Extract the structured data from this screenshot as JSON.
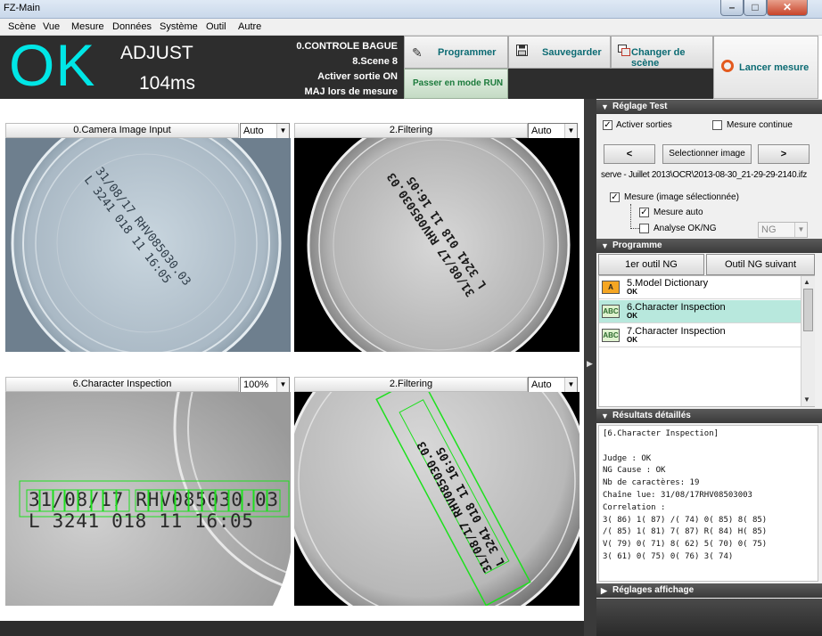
{
  "window": {
    "title": "FZ-Main",
    "min_glyph": "–",
    "max_glyph": "□",
    "close_glyph": "✕"
  },
  "menu": [
    "Scène",
    "Vue",
    "Mesure",
    "Données",
    "Système",
    "Outil",
    "Autre"
  ],
  "status": {
    "judge": "OK",
    "judge_color": "#00e6e6",
    "mode": "ADJUST",
    "time": "104ms",
    "scene_group": "0.CONTROLE BAGUE",
    "scene": "8.Scene 8",
    "output": "Activer sortie ON",
    "update": "MAJ lors de mesure"
  },
  "toolbar": {
    "program_label": "Programmer",
    "save_label": "Sauvegarder",
    "change_scene_label": "Changer de scène",
    "run_mode_label": "Passer en mode RUN",
    "launch_label": "Lancer mesure"
  },
  "panes": [
    {
      "title": "0.Camera Image Input",
      "zoom": "Auto"
    },
    {
      "title": "2.Filtering",
      "zoom": "Auto"
    },
    {
      "title": "6.Character Inspection",
      "zoom": "100%"
    },
    {
      "title": "2.Filtering",
      "zoom": "Auto"
    }
  ],
  "image_text": {
    "line1": "31/08/17 RHV085030.03",
    "line2": "L 3241 018 11 16:05"
  },
  "test": {
    "header": "Réglage Test",
    "activate_outputs": "Activer sorties",
    "continuous": "Mesure continue",
    "prev": "<",
    "select_image": "Selectionner image",
    "next": ">",
    "path": "serve - Juillet 2013\\OCR\\2013-08-30_21-29-29-2140.ifz",
    "measure_selected": "Mesure (image sélectionnée)",
    "auto_measure": "Mesure auto",
    "okng": "Analyse OK/NG",
    "okng_value": "NG"
  },
  "program": {
    "header": "Programme",
    "first_ng": "1er outil NG",
    "next_ng": "Outil NG suivant",
    "items": [
      {
        "name": "5.Model Dictionary",
        "status": "OK",
        "icon": "A"
      },
      {
        "name": "6.Character Inspection",
        "status": "OK",
        "icon": "ABC"
      },
      {
        "name": "7.Character Inspection",
        "status": "OK",
        "icon": "ABC"
      }
    ]
  },
  "results": {
    "header": "Résultats détaillés",
    "text": "[6.Character Inspection]\n\nJudge : OK\nNG Cause : OK\nNb de caractères: 19\nChaîne lue: 31/08/17RHV08503003\nCorrelation :\n3( 86) 1( 87) /( 74) 0( 85) 8( 85)\n/( 85) 1( 81) 7( 87) R( 84) H( 85)\nV( 79) 0( 71) 8( 62) 5( 70) 0( 75)\n3( 61) 0( 75) 0( 76) 3( 74)"
  },
  "display": {
    "header": "Réglages affichage"
  }
}
